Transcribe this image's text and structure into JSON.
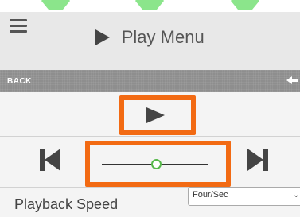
{
  "header": {
    "title": "Play Menu"
  },
  "backbar": {
    "label": "BACK"
  },
  "playback": {
    "speed_label": "Playback Speed",
    "speed_value": "Four/Sec",
    "chevron": "⌄",
    "slider_position": 0.5
  },
  "icons": [
    "hamburger-icon",
    "play-icon",
    "back-arrow-icon",
    "skip-previous-icon",
    "skip-next-icon",
    "chevron-down-icon"
  ],
  "colors": {
    "highlight": "#f26a13",
    "slider_thumb": "#56b84a",
    "header_bg": "#e8e8e8",
    "backbar_bg": "#8e8e8e",
    "accent_hex": "#7ee27e"
  }
}
